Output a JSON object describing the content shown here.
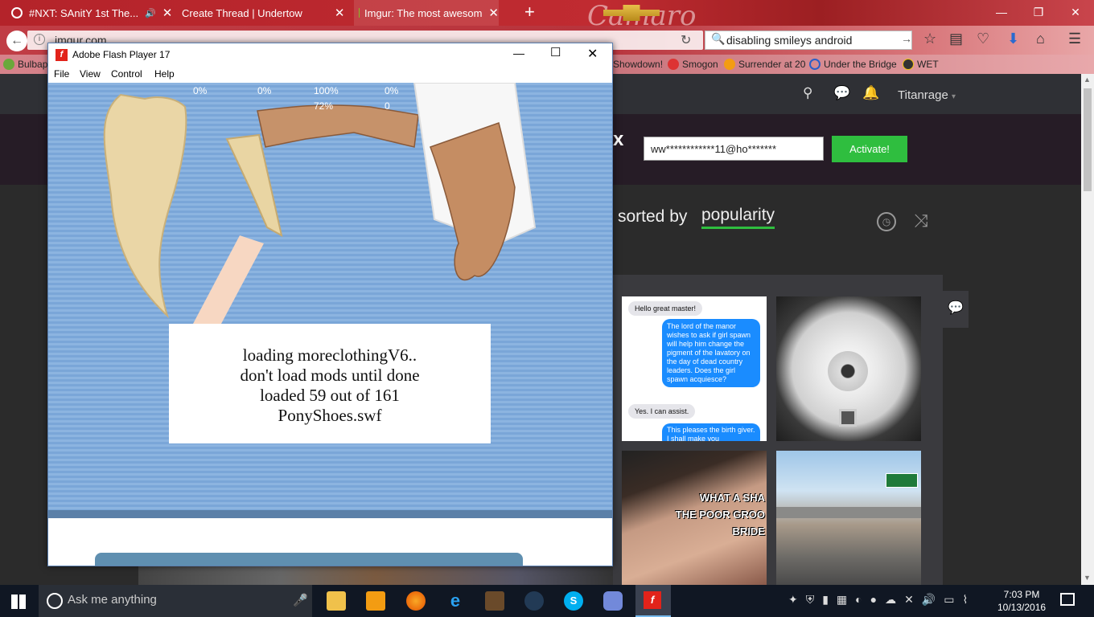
{
  "browser": {
    "tabs": [
      {
        "label": "#NXT: SAnitY 1st The...",
        "mute_icon": "🔊"
      },
      {
        "label": "Create Thread | Undertow"
      },
      {
        "label": "Imgur: The most awesom"
      }
    ],
    "new_tab": "+",
    "brand_text": "Camaro",
    "url": "imgur.com",
    "search": "disabling smileys android",
    "bookmarks": [
      "Bulbap",
      "Showdown!",
      "Smogon",
      "Surrender at 20",
      "Under the Bridge",
      "WET"
    ]
  },
  "flash": {
    "title": "Adobe Flash Player 17",
    "menu": [
      "File",
      "View",
      "Control",
      "Help"
    ],
    "stats": [
      "0%",
      "0%",
      "100%",
      "72%",
      "0%",
      "0"
    ],
    "loading": [
      "loading moreclothingV6..",
      "don't load mods until done",
      "loaded 59 out of 161",
      "PonyShoes.swf"
    ]
  },
  "imgur": {
    "username": "Titanrage",
    "banner_partial": "x",
    "email": "ww************11@ho*******",
    "activate": "Activate!",
    "sorted_by": "sorted by",
    "sort_value": "popularity",
    "chat_lines": [
      {
        "side": "left",
        "text": "Hello great master!"
      },
      {
        "side": "right",
        "text": "The lord of the manor wishes to ask if girl spawn will help him change the pigment of the lavatory on the day of dead country leaders. Does the girl spawn acquiesce?"
      },
      {
        "side": "left",
        "text": "Yes. I can assist."
      },
      {
        "side": "right",
        "text": "This pleases the birth giver. I shall make you"
      }
    ],
    "meme_text": [
      "WHAT A SHA",
      "THE POOR GROO",
      "BRIDE"
    ]
  },
  "taskbar": {
    "search_placeholder": "Ask me anything",
    "time": "7:03 PM",
    "date": "10/13/2016"
  },
  "colors": {
    "accent": "#2fbe3f",
    "flash_red": "#e2231a",
    "taskbar": "#101723"
  }
}
